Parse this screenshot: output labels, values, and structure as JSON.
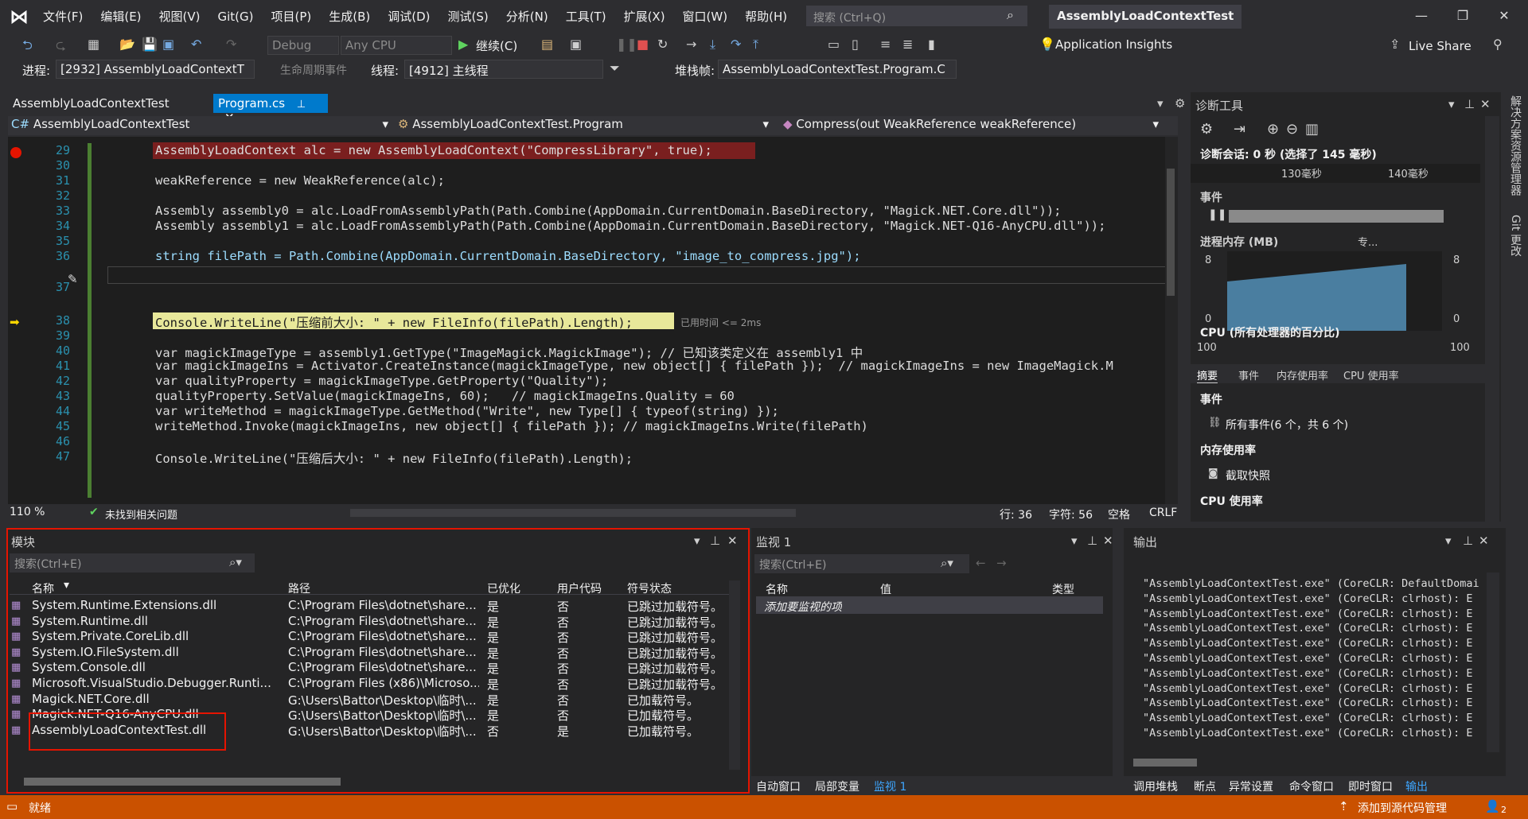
{
  "menu": [
    "文件(F)",
    "编辑(E)",
    "视图(V)",
    "Git(G)",
    "项目(P)",
    "生成(B)",
    "调试(D)",
    "测试(S)",
    "分析(N)",
    "工具(T)",
    "扩展(X)",
    "窗口(W)",
    "帮助(H)"
  ],
  "search": {
    "placeholder": "搜索 (Ctrl+Q)"
  },
  "solution_title": "AssemblyLoadContextTest",
  "toolbar": {
    "config": "Debug",
    "platform": "Any CPU",
    "continue": "继续(C)",
    "app_insights": "Application Insights",
    "live_share": "Live Share"
  },
  "debugbar": {
    "process_label": "进程:",
    "process": "[2932] AssemblyLoadContextT",
    "lifecycle": "生命周期事件",
    "thread_label": "线程:",
    "thread": "[4912] 主线程",
    "stack_label": "堆栈帧:",
    "stack": "AssemblyLoadContextTest.Program.C"
  },
  "tabs": {
    "project": "AssemblyLoadContextTest",
    "file": "Program.cs"
  },
  "nav": {
    "project": "AssemblyLoadContextTest",
    "class": "AssemblyLoadContextTest.Program",
    "member": "Compress(out WeakReference weakReference)"
  },
  "lines": [
    "29",
    "30",
    "31",
    "32",
    "33",
    "34",
    "35",
    "36",
    "37",
    "38",
    "39",
    "40",
    "41",
    "42",
    "43",
    "44",
    "45",
    "46",
    "47"
  ],
  "code": {
    "l29": "AssemblyLoadContext alc = new AssemblyLoadContext(\"CompressLibrary\", true);",
    "l31": "weakReference = new WeakReference(alc);",
    "l33": "Assembly assembly0 = alc.LoadFromAssemblyPath(Path.Combine(AppDomain.CurrentDomain.BaseDirectory, \"Magick.NET.Core.dll\"));",
    "l34": "Assembly assembly1 = alc.LoadFromAssemblyPath(Path.Combine(AppDomain.CurrentDomain.BaseDirectory, \"Magick.NET-Q16-AnyCPU.dll\"));",
    "l36": "string filePath = Path.Combine(AppDomain.CurrentDomain.BaseDirectory, \"image_to_compress.jpg\");",
    "l38": "Console.WriteLine(\"压缩前大小: \" + new FileInfo(filePath).Length);",
    "l38_hint": "已用时间 <= 2ms",
    "l40": "var magickImageType = assembly1.GetType(\"ImageMagick.MagickImage\"); // 已知该类定义在 assembly1 中",
    "l41": "var magickImageIns = Activator.CreateInstance(magickImageType, new object[] { filePath });  // magickImageIns = new ImageMagick.M",
    "l42": "var qualityProperty = magickImageType.GetProperty(\"Quality\");",
    "l43": "qualityProperty.SetValue(magickImageIns, 60);   // magickImageIns.Quality = 60",
    "l44": "var writeMethod = magickImageType.GetMethod(\"Write\", new Type[] { typeof(string) });",
    "l45": "writeMethod.Invoke(magickImageIns, new object[] { filePath }); // magickImageIns.Write(filePath)",
    "l47": "Console.WriteLine(\"压缩后大小: \" + new FileInfo(filePath).Length);"
  },
  "editor_status": {
    "zoom": "110 %",
    "issues": "未找到相关问题",
    "line": "行: 36",
    "char": "字符: 56",
    "space": "空格",
    "eol": "CRLF"
  },
  "modules": {
    "title": "模块",
    "search": "搜索(Ctrl+E)",
    "headers": [
      "名称",
      "路径",
      "已优化",
      "用户代码",
      "符号状态"
    ],
    "rows": [
      [
        "System.Runtime.Extensions.dll",
        "C:\\Program Files\\dotnet\\share...",
        "是",
        "否",
        "已跳过加载符号。"
      ],
      [
        "System.Runtime.dll",
        "C:\\Program Files\\dotnet\\share...",
        "是",
        "否",
        "已跳过加载符号。"
      ],
      [
        "System.Private.CoreLib.dll",
        "C:\\Program Files\\dotnet\\share...",
        "是",
        "否",
        "已跳过加载符号。"
      ],
      [
        "System.IO.FileSystem.dll",
        "C:\\Program Files\\dotnet\\share...",
        "是",
        "否",
        "已跳过加载符号。"
      ],
      [
        "System.Console.dll",
        "C:\\Program Files\\dotnet\\share...",
        "是",
        "否",
        "已跳过加载符号。"
      ],
      [
        "Microsoft.VisualStudio.Debugger.Runti...",
        "C:\\Program Files (x86)\\Microso...",
        "是",
        "否",
        "已跳过加载符号。"
      ],
      [
        "Magick.NET.Core.dll",
        "G:\\Users\\Battor\\Desktop\\临时\\...",
        "是",
        "否",
        "已加载符号。"
      ],
      [
        "Magick.NET-Q16-AnyCPU.dll",
        "G:\\Users\\Battor\\Desktop\\临时\\...",
        "是",
        "否",
        "已加载符号。"
      ],
      [
        "AssemblyLoadContextTest.dll",
        "G:\\Users\\Battor\\Desktop\\临时\\...",
        "否",
        "是",
        "已加载符号。"
      ]
    ]
  },
  "watch": {
    "title": "监视 1",
    "search": "搜索(Ctrl+E)",
    "headers": [
      "名称",
      "值",
      "类型"
    ],
    "add": "添加要监视的项"
  },
  "output": {
    "title": "输出",
    "lines": [
      "\"AssemblyLoadContextTest.exe\" (CoreCLR: DefaultDomai",
      "\"AssemblyLoadContextTest.exe\" (CoreCLR: clrhost): E",
      "\"AssemblyLoadContextTest.exe\" (CoreCLR: clrhost): E",
      "\"AssemblyLoadContextTest.exe\" (CoreCLR: clrhost): E",
      "\"AssemblyLoadContextTest.exe\" (CoreCLR: clrhost): E",
      "\"AssemblyLoadContextTest.exe\" (CoreCLR: clrhost): E",
      "\"AssemblyLoadContextTest.exe\" (CoreCLR: clrhost): E",
      "\"AssemblyLoadContextTest.exe\" (CoreCLR: clrhost): E",
      "\"AssemblyLoadContextTest.exe\" (CoreCLR: clrhost): E",
      "\"AssemblyLoadContextTest.exe\" (CoreCLR: clrhost): E",
      "\"AssemblyLoadContextTest.exe\" (CoreCLR: clrhost): E"
    ]
  },
  "bottom_tabs_mid": [
    "自动窗口",
    "局部变量",
    "监视 1"
  ],
  "bottom_tabs_right": [
    "调用堆栈",
    "断点",
    "异常设置",
    "命令窗口",
    "即时窗口",
    "输出"
  ],
  "diag": {
    "title": "诊断工具",
    "session": "诊断会话: 0 秒 (选择了 145 毫秒)",
    "t1": "130毫秒",
    "t2": "140毫秒",
    "events": "事件",
    "memory": "进程内存 (MB)",
    "mem_legend": "专...",
    "mem_max": "8",
    "mem_min": "0",
    "cpu": "CPU (所有处理器的百分比)",
    "cpu_max": "100",
    "tabs": [
      "摘要",
      "事件",
      "内存使用率",
      "CPU 使用率"
    ],
    "sec_events": "事件",
    "all_events": "所有事件(6 个，共 6 个)",
    "sec_memory": "内存使用率",
    "snapshot": "截取快照",
    "sec_cpu": "CPU 使用率"
  },
  "side": [
    "解决方案资源管理器",
    "Git 更改"
  ],
  "status": {
    "ready": "就绪",
    "source_control": "添加到源代码管理",
    "notif": "2"
  }
}
